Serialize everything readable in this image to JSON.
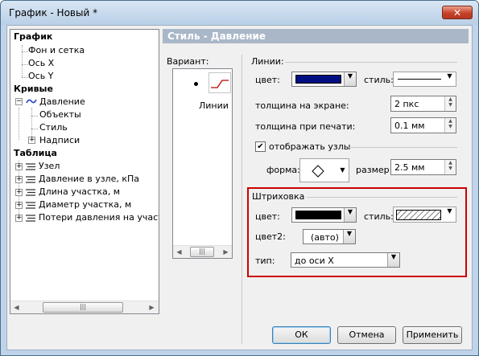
{
  "window": {
    "title": "График - Новый *",
    "close_glyph": "✕"
  },
  "tree": {
    "items": [
      {
        "label": "График",
        "bold": true
      },
      {
        "label": "Фон и сетка"
      },
      {
        "label": "Ось X"
      },
      {
        "label": "Ось Y"
      },
      {
        "label": "Кривые",
        "bold": true
      },
      {
        "label": "Давление",
        "icon": "curve-line-icon"
      },
      {
        "label": "Объекты"
      },
      {
        "label": "Стиль"
      },
      {
        "label": "Надписи"
      },
      {
        "label": "Таблица",
        "bold": true
      },
      {
        "label": "Узел",
        "icon": "table-column-icon"
      },
      {
        "label": "Давление в узле, кПа",
        "icon": "table-column-icon"
      },
      {
        "label": "Длина участка, м",
        "icon": "table-column-icon"
      },
      {
        "label": "Диаметр участка, м",
        "icon": "table-column-icon"
      },
      {
        "label": "Потери давления на участк",
        "icon": "table-column-icon"
      }
    ],
    "expand_minus": "−",
    "expand_plus": "+"
  },
  "panel": {
    "header": "Стиль - Давление",
    "variant": {
      "label": "Вариант:",
      "option_label": "Линии"
    },
    "lines": {
      "group_label": "Линии:",
      "color_label": "цвет:",
      "color_value": "#001080",
      "style_label": "стиль:",
      "screen_width_label": "толщина на экране:",
      "screen_width_value": "2 пкс",
      "print_width_label": "толщина при печати:",
      "print_width_value": "0.1 мм",
      "show_nodes_label": "отображать узлы",
      "show_nodes_checked": true,
      "shape_label": "форма:",
      "shape_icon": "diamond-icon",
      "size_label": "размер:",
      "size_value": "2.5 мм"
    },
    "hatch": {
      "group_label": "Штриховка",
      "color_label": "цвет:",
      "color_value": "#000000",
      "style_label": "стиль:",
      "color2_label": "цвет2:",
      "color2_value": "(авто)",
      "type_label": "тип:",
      "type_value": "до оси X",
      "highlight_color": "#cc0000"
    }
  },
  "buttons": {
    "ok": "ОК",
    "cancel": "Отмена",
    "apply": "Применить"
  },
  "colors": {
    "header_bg": "#a9b7c8",
    "title_bar": "#c7daee"
  }
}
